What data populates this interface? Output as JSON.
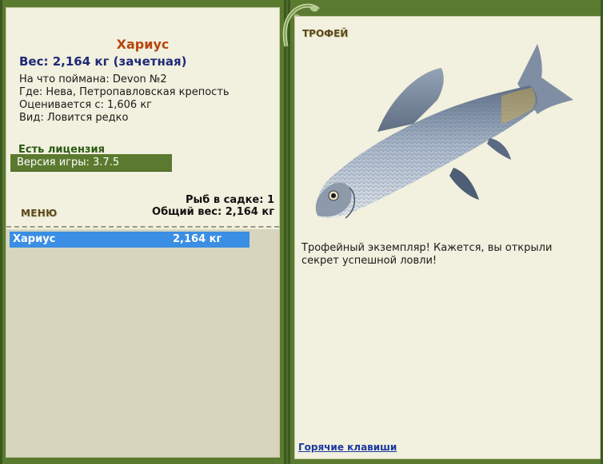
{
  "fish": {
    "name": "Хариус",
    "weight_line": "Вес: 2,164 кг (зачетная)",
    "caught_on": "На что поймана: Devon №2",
    "location": "Где: Нева, Петропавловская крепость",
    "rated_from": "Оценивается с: 1,606 кг",
    "type": "Вид: Ловится редко"
  },
  "license": "Есть лицензия",
  "version": "Версия игры: 3.7.5",
  "menu_label": "МЕНЮ",
  "keepnet": {
    "count_label": "Рыб в садке: 1",
    "total_label": "Общий вес: 2,164 кг",
    "items": [
      {
        "name": "Хариус",
        "weight": "2,164 кг"
      }
    ]
  },
  "trophy": {
    "heading": "ТРОФЕЙ",
    "text": "Трофейный экземпляр! Кажется, вы открыли секрет успешной ловли!"
  },
  "hotkeys_label": "Горячие клавиши",
  "colors": {
    "frame": "#5a7a30",
    "panel": "#f2f0de",
    "title": "#b8460f",
    "weight": "#1e2a78",
    "selection": "#3a8ee3",
    "link": "#1a3aa0"
  }
}
